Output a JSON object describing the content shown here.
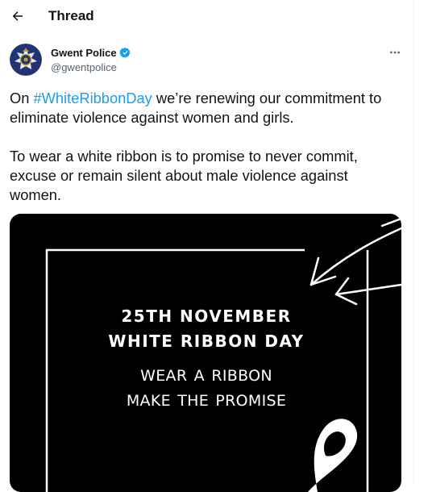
{
  "header": {
    "title": "Thread",
    "back_icon": "arrow-left-icon"
  },
  "tweet": {
    "author": {
      "name": "Gwent Police",
      "handle": "@gwentpolice",
      "verified_icon": "verified-badge-icon",
      "avatar_icon": "police-star-badge-icon"
    },
    "more_icon": "more-horizontal-icon",
    "text": {
      "prefix": "On ",
      "hashtag": "#WhiteRibbonDay",
      "line1_rest": " we’re renewing our commitment to eliminate violence against women and girls.",
      "paragraph2": "To wear a white ribbon is to promise to never commit, excuse or remain silent about male violence against women."
    },
    "media": {
      "line1": "25TH NOVEMBER",
      "line2": "WHITE RIBBON DAY",
      "line3": "WEAR A RIBBON",
      "line4": "MAKE  THE PROMISE",
      "decorations": [
        "arrow-icon",
        "white-ribbon-icon"
      ]
    }
  },
  "colors": {
    "link": "#1d9bf0",
    "text": "#0f1419",
    "muted": "#536471",
    "verified": "#1d9bf0",
    "avatar_bg": "#1f3470",
    "media_bg": "#000000"
  }
}
